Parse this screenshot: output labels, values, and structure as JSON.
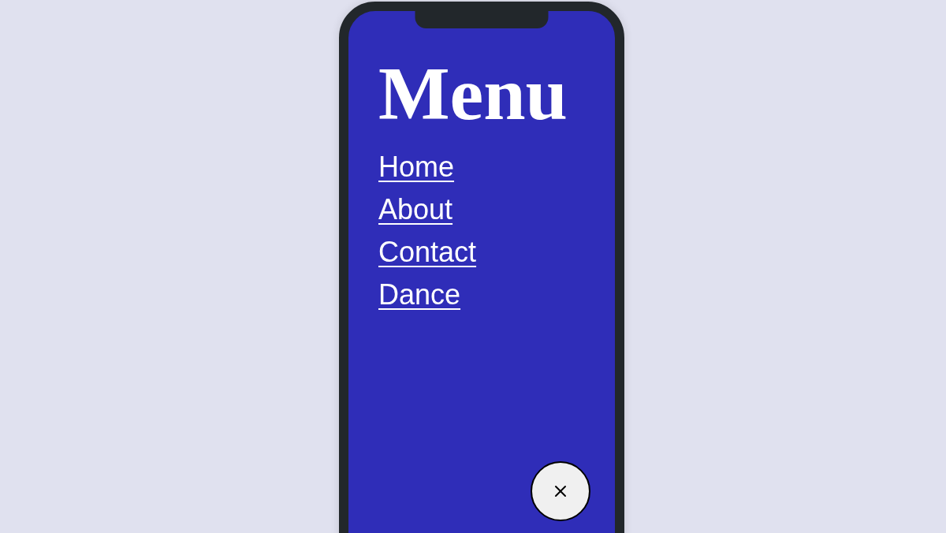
{
  "menu": {
    "title": "Menu",
    "links": [
      {
        "label": "Home"
      },
      {
        "label": "About"
      },
      {
        "label": "Contact"
      },
      {
        "label": "Dance"
      }
    ]
  }
}
